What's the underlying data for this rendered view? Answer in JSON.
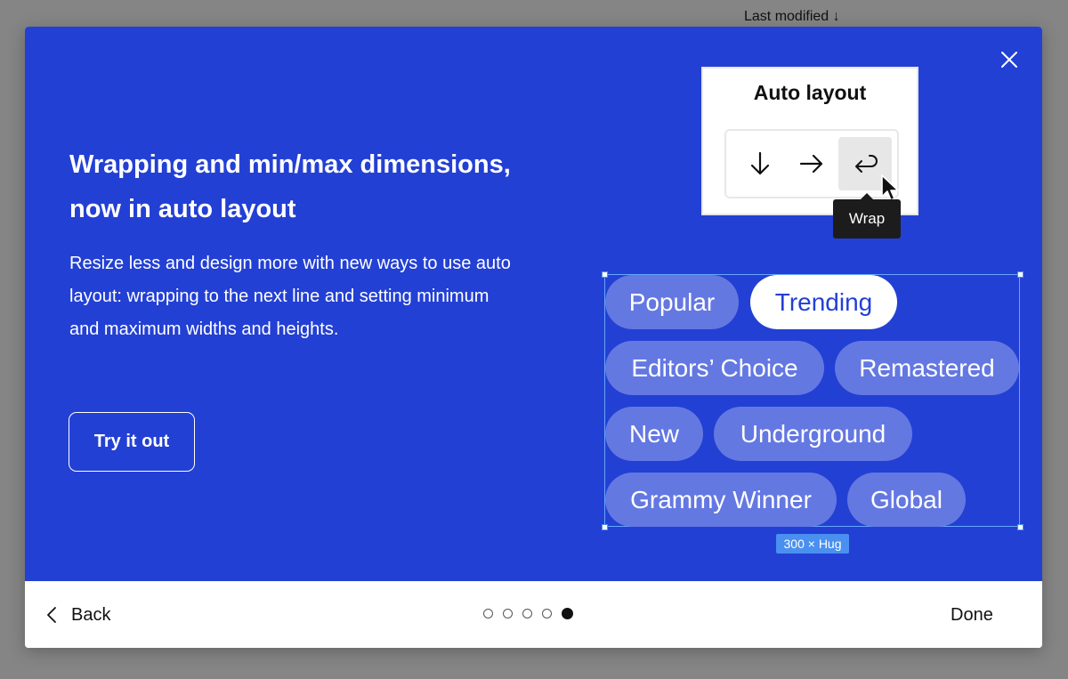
{
  "background": {
    "sort_label": "Last modified ↓"
  },
  "modal": {
    "title": "Wrapping and min/max dimensions, now in auto layout",
    "description": "Resize less and design more with new ways to use auto layout: wrapping to the next line and setting minimum and maximum widths and heights.",
    "cta_label": "Try it out",
    "close_icon": "close-icon",
    "illustration": {
      "card_title": "Auto layout",
      "options": [
        "arrow-down-icon",
        "arrow-right-icon",
        "wrap-icon"
      ],
      "selected_option": "wrap-icon",
      "tooltip": "Wrap",
      "chips": [
        {
          "label": "Popular",
          "active": false
        },
        {
          "label": "Trending",
          "active": true
        },
        {
          "label": "Editors’ Choice",
          "active": false
        },
        {
          "label": "Remastered",
          "active": false
        },
        {
          "label": "New",
          "active": false
        },
        {
          "label": "Underground",
          "active": false
        },
        {
          "label": "Grammy Winner",
          "active": false
        },
        {
          "label": "Global",
          "active": false
        }
      ],
      "size_badge": "300 × Hug"
    },
    "footer": {
      "back_label": "Back",
      "done_label": "Done",
      "pages_total": 5,
      "current_page": 5
    }
  },
  "colors": {
    "hero_bg": "#2340d4",
    "chip_bg": "#6478e2",
    "chip_active_bg": "#ffffff",
    "selection": "#4a90f0",
    "overlay": "#858585"
  }
}
